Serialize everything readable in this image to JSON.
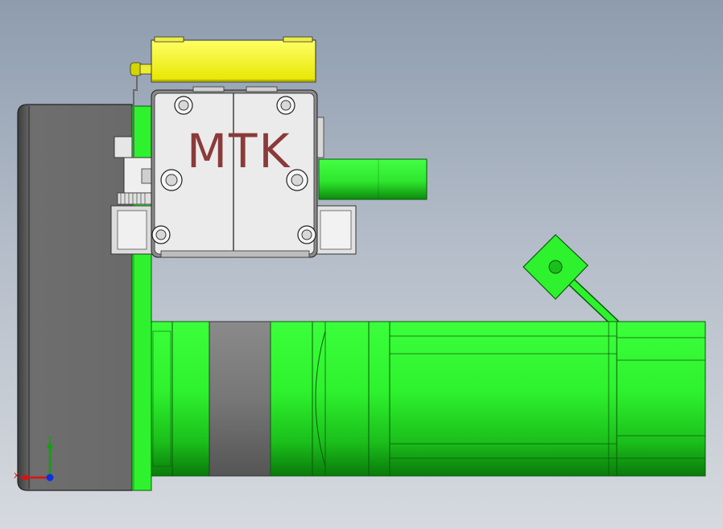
{
  "drawing": {
    "logo_text": "MTK",
    "axis_labels": {
      "x": "X",
      "y": "Y"
    }
  },
  "colors": {
    "viewport_top": "#8e9cae",
    "viewport_bottom": "#d6dadf",
    "motor_green": "#2ef22e",
    "motor_dark_green": "#0c9a0c",
    "plate_gray": "#6b6b6b",
    "housing_gray": "#e8e8e8",
    "cover_yellow": "#ffff33",
    "logo_text": "#8b3a3a",
    "axis_x": "#e01010",
    "axis_y": "#10a010",
    "axis_z": "#1030e0"
  },
  "icons": {
    "triad": "coordinate-triad-icon"
  }
}
